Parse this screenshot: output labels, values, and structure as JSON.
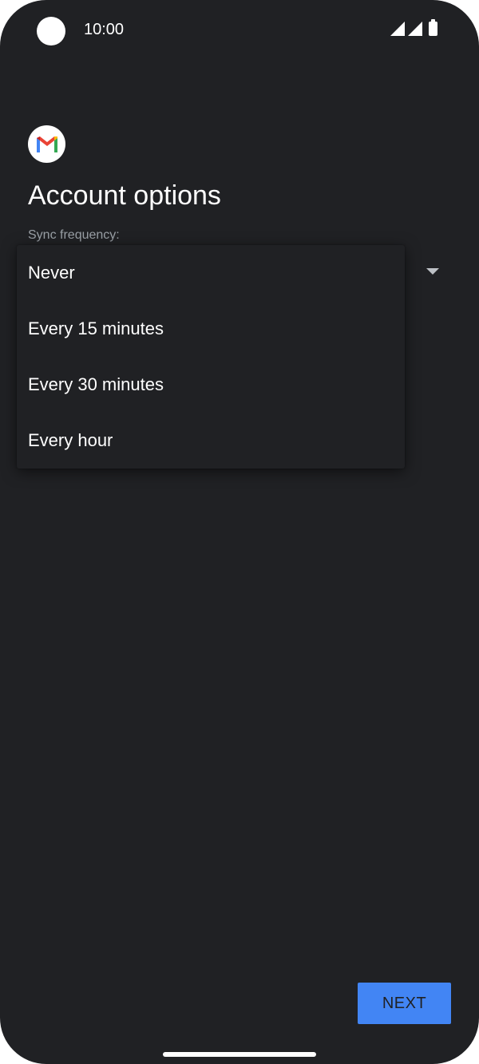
{
  "status_bar": {
    "time": "10:00"
  },
  "icons": {
    "app": "gmail-icon",
    "signal": "signal-icon",
    "battery": "battery-icon",
    "dropdown": "dropdown-arrow-icon"
  },
  "header": {
    "title": "Account options"
  },
  "sync": {
    "label": "Sync frequency:",
    "options": [
      {
        "label": "Never"
      },
      {
        "label": "Every 15 minutes"
      },
      {
        "label": "Every 30 minutes"
      },
      {
        "label": "Every hour"
      }
    ]
  },
  "footer": {
    "next_label": "NEXT"
  },
  "colors": {
    "background": "#202124",
    "accent": "#4285f4",
    "text_primary": "#ffffff",
    "text_secondary": "#9aa0a6"
  }
}
